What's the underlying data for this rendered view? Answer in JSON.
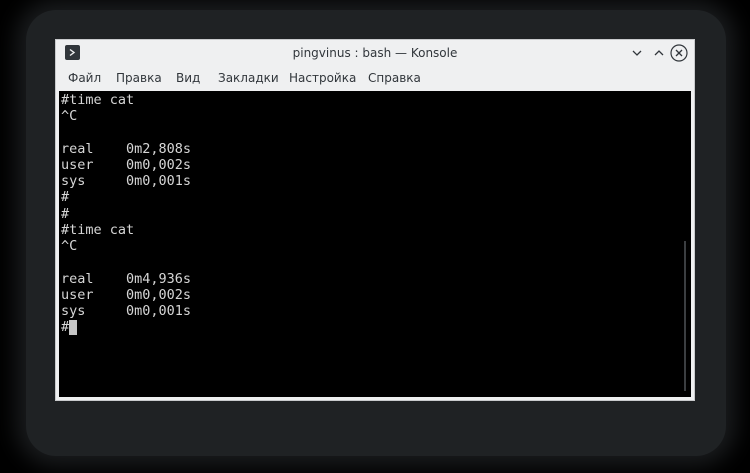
{
  "window": {
    "title": "pingvinus : bash — Konsole",
    "icon": "terminal-icon",
    "controls": [
      "minimize-icon",
      "maximize-icon",
      "close-icon"
    ]
  },
  "menubar": {
    "items": [
      {
        "label": "Файл"
      },
      {
        "label": "Правка"
      },
      {
        "label": "Вид"
      },
      {
        "label": "Закладки"
      },
      {
        "label": "Настройка"
      },
      {
        "label": "Справка"
      }
    ]
  },
  "terminal": {
    "lines": [
      "#time cat",
      "^C",
      "",
      "real    0m2,808s",
      "user    0m0,002s",
      "sys     0m0,001s",
      "#",
      "#",
      "#time cat",
      "^C",
      "",
      "real    0m4,936s",
      "user    0m0,002s",
      "sys     0m0,001s",
      "#"
    ]
  },
  "colors": {
    "window_bg": "#eff0f1",
    "terminal_bg": "#000000",
    "terminal_fg": "#d6d6d6",
    "text": "#31363b"
  }
}
